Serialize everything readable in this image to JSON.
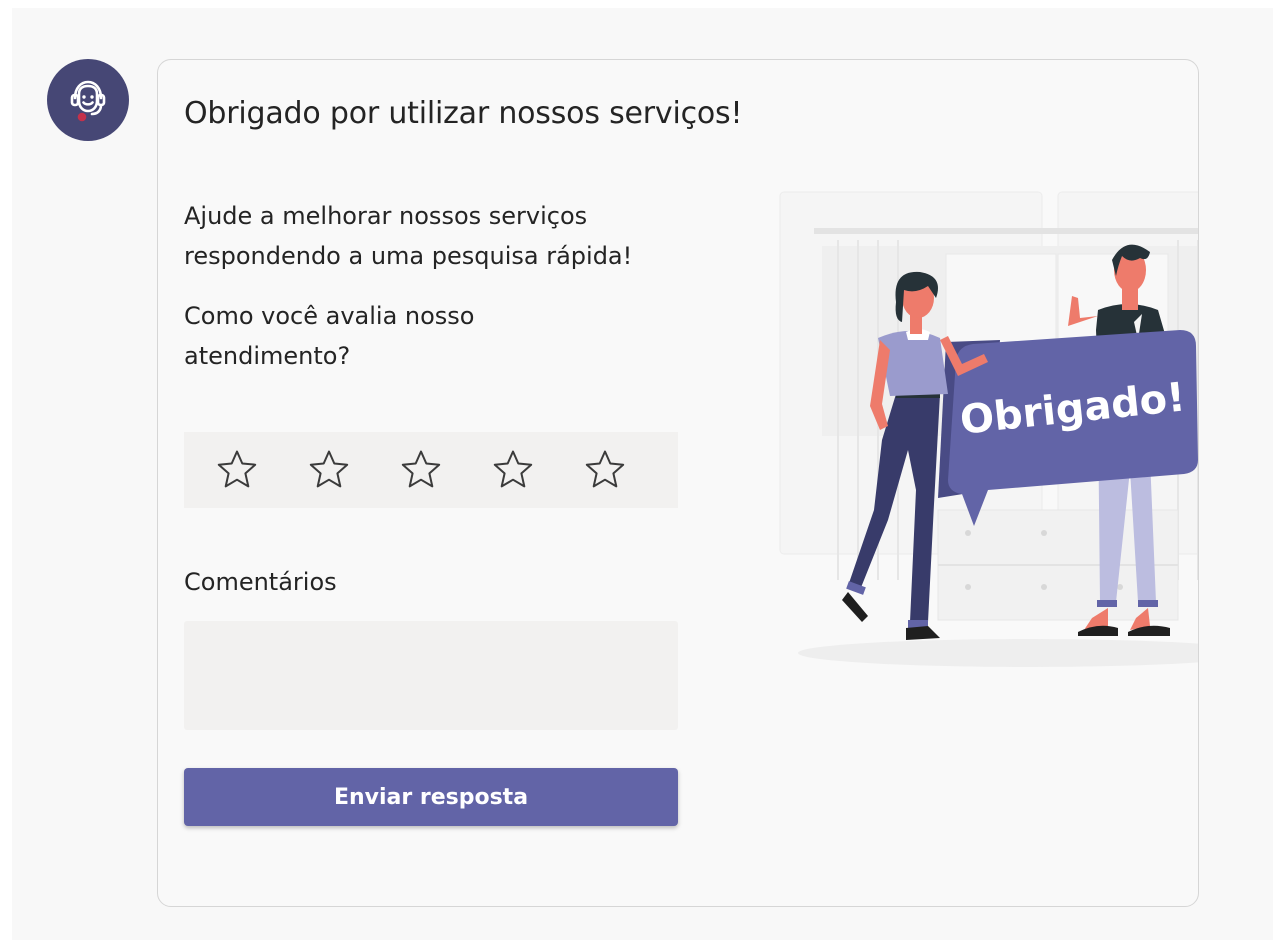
{
  "card": {
    "title": "Obrigado por utilizar nossos serviços!",
    "intro": "Ajude a melhorar nossos serviços respondendo a uma pesquisa rápida!",
    "question": "Como você avalia nosso atendimento?",
    "rating": {
      "max": 5,
      "selected": 0
    },
    "comments_label": "Comentários",
    "comments_value": "",
    "submit_label": "Enviar resposta"
  },
  "illustration": {
    "sign_text": "Obrigado!"
  },
  "colors": {
    "accent": "#6264a7",
    "avatar_bg": "#464775",
    "input_bg": "#f2f1f0",
    "text": "#242424"
  },
  "icons": {
    "avatar": "support-agent-headset-icon",
    "rating": "star-outline-icon"
  }
}
